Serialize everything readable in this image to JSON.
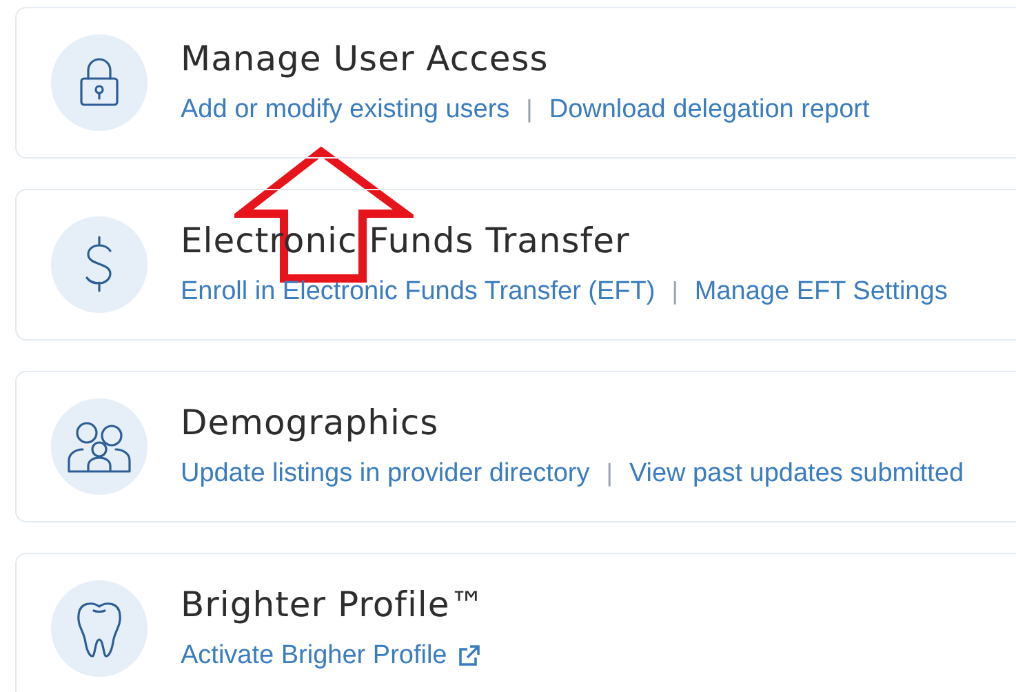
{
  "cards": [
    {
      "title": "Manage User Access",
      "links": [
        {
          "label": "Add or modify existing users",
          "external": false
        },
        {
          "label": "Download delegation report",
          "external": false
        }
      ]
    },
    {
      "title": "Electronic Funds Transfer",
      "links": [
        {
          "label": "Enroll in Electronic Funds Transfer (EFT)",
          "external": false
        },
        {
          "label": "Manage EFT Settings",
          "external": false
        }
      ]
    },
    {
      "title": "Demographics",
      "links": [
        {
          "label": "Update listings in provider directory",
          "external": false
        },
        {
          "label": "View past updates submitted",
          "external": false
        }
      ]
    },
    {
      "title": "Brighter Profile™",
      "links": [
        {
          "label": "Activate Brigher Profile",
          "external": true
        }
      ]
    }
  ],
  "separator": "|"
}
